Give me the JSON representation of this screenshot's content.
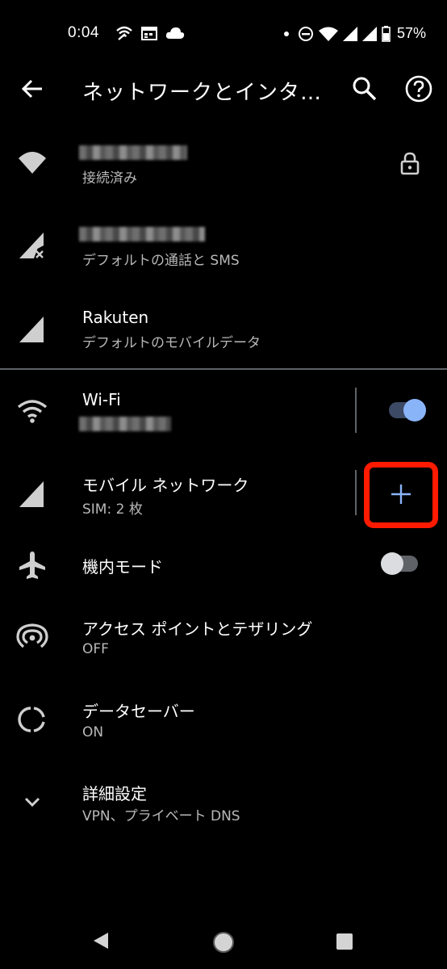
{
  "status_bar": {
    "time": "0:04",
    "battery": "57%",
    "icons_left": [
      "wifi-calling-icon",
      "calendar-icon",
      "cloud-icon"
    ],
    "icons_right": [
      "dot-icon",
      "do-not-disturb-icon",
      "wifi-icon",
      "signal-icon",
      "signal-icon",
      "battery-icon"
    ]
  },
  "toolbar": {
    "title": "ネットワークとインタ…"
  },
  "sim_cards": [
    {
      "subtitle": "接続済み"
    },
    {
      "subtitle": "デフォルトの通話と SMS"
    },
    {
      "title": "Rakuten",
      "subtitle": "デフォルトのモバイルデータ"
    }
  ],
  "wifi": {
    "title": "Wi-Fi",
    "enabled": true
  },
  "mobile_network": {
    "title": "モバイル ネットワーク",
    "subtitle": "SIM: 2 枚"
  },
  "airplane": {
    "title": "機内モード",
    "enabled": false
  },
  "hotspot": {
    "title": "アクセス ポイントとテザリング",
    "subtitle": "OFF"
  },
  "data_saver": {
    "title": "データセーバー",
    "subtitle": "ON"
  },
  "advanced": {
    "title": "詳細設定",
    "subtitle": "VPN、プライベート DNS"
  },
  "colors": {
    "accent": "#8ab4f8",
    "highlight": "#ff1a00",
    "icon_gray": "#cfcfcf",
    "background": "#000000"
  }
}
